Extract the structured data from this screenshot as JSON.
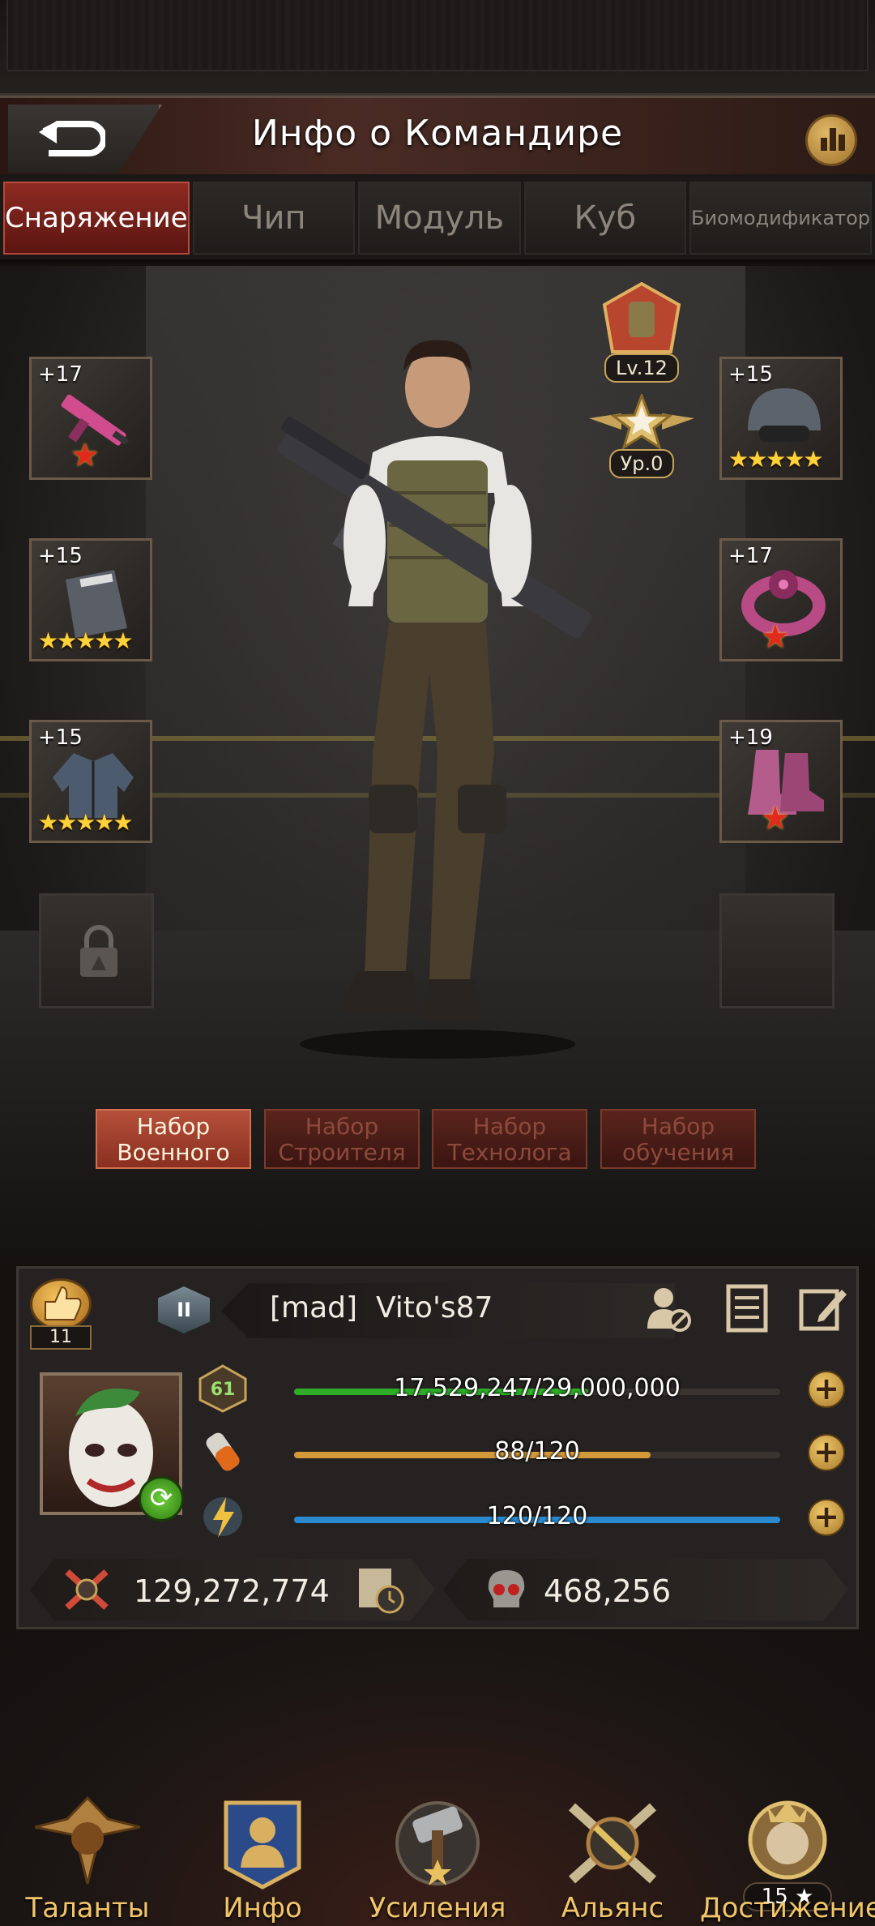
{
  "header": {
    "title": "Инфо о Командире"
  },
  "tabs": [
    {
      "label": "Снаряжение",
      "active": true
    },
    {
      "label": "Чип",
      "active": false
    },
    {
      "label": "Модуль",
      "active": false
    },
    {
      "label": "Куб",
      "active": false
    },
    {
      "label": "Биомодификатор",
      "active": false
    }
  ],
  "badges": {
    "level": "Lv.12",
    "rank": "Ур.0"
  },
  "equipment": {
    "weapon": {
      "level": "+17",
      "rating": "★",
      "icon": "smg-icon"
    },
    "helmet": {
      "level": "+15",
      "rating": "★★★★★",
      "icon": "helmet-icon"
    },
    "armor_plate": {
      "level": "+15",
      "rating": "★★★★★",
      "icon": "armor-plate-icon"
    },
    "ring": {
      "level": "+17",
      "rating": "★",
      "icon": "biohazard-ring-icon"
    },
    "jacket": {
      "level": "+15",
      "rating": "★★★★★",
      "icon": "jacket-icon"
    },
    "boots": {
      "level": "+19",
      "rating": "★",
      "icon": "boots-icon"
    }
  },
  "sets": [
    {
      "line1": "Набор",
      "line2": "Военного",
      "active": true
    },
    {
      "line1": "Набор",
      "line2": "Строителя",
      "active": false
    },
    {
      "line1": "Набор",
      "line2": "Технолога",
      "active": false
    },
    {
      "line1": "Набор",
      "line2": "обучения",
      "active": false
    }
  ],
  "profile": {
    "likes": "11",
    "rank_numeral": "II",
    "tag": "[mad]",
    "name": "Vito's87",
    "level": "61",
    "xp": {
      "text": "17,529,247/29,000,000",
      "fraction": 0.6045,
      "color": "#2fae2a"
    },
    "stamina": {
      "text": "88/120",
      "fraction": 0.7333,
      "color": "#d49a3a"
    },
    "energy": {
      "text": "120/120",
      "fraction": 1.0,
      "color": "#2a8ad0"
    },
    "power": "129,272,774",
    "kills": "468,256"
  },
  "nav": [
    {
      "label": "Таланты",
      "icon": "talents-icon"
    },
    {
      "label": "Инфо",
      "icon": "info-icon"
    },
    {
      "label": "Усиления",
      "icon": "boosts-icon"
    },
    {
      "label": "Альянс",
      "icon": "alliance-icon"
    },
    {
      "label": "Достижение",
      "icon": "achievement-icon",
      "count": "15 ★"
    }
  ]
}
